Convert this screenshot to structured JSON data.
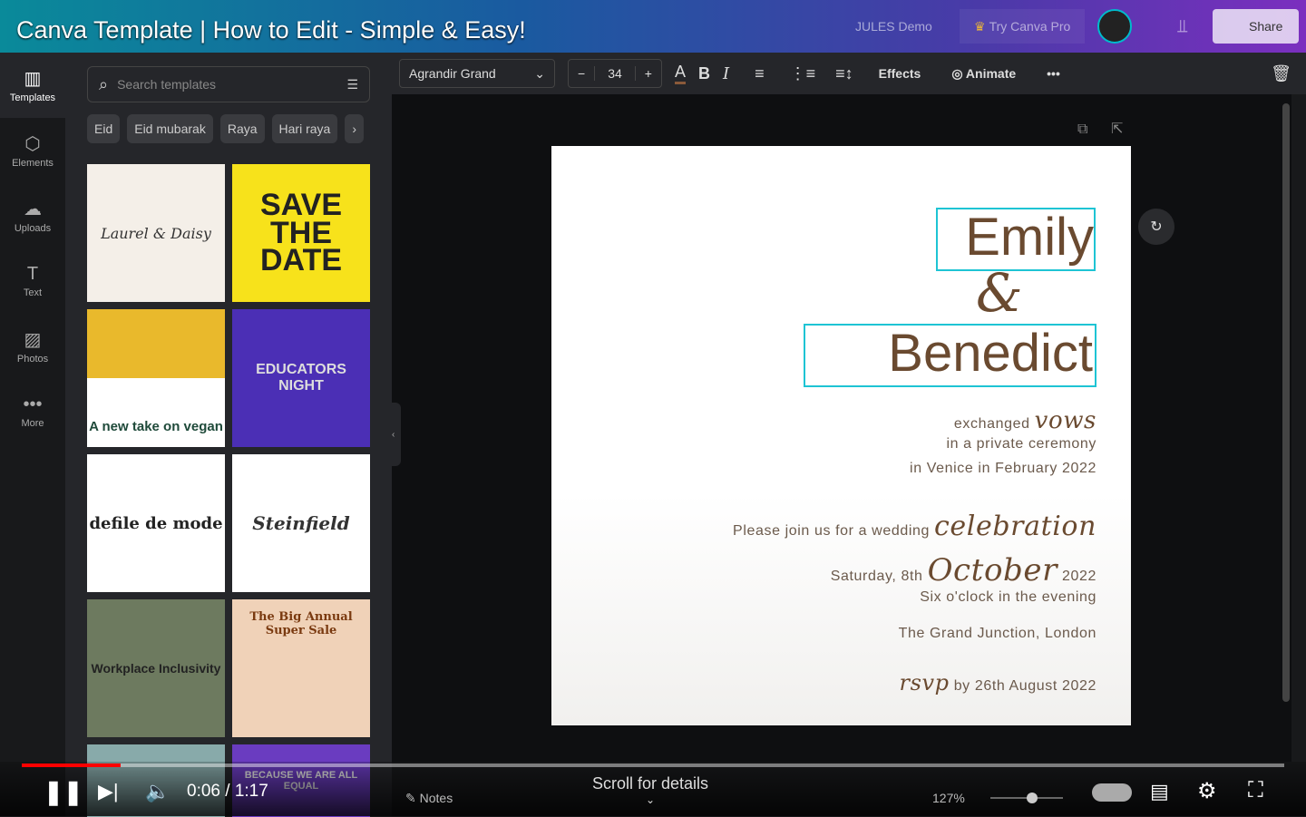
{
  "video": {
    "title": "Canva Template | How to Edit - Simple & Easy!",
    "time": "0:06 / 1:17",
    "progress": 0.078,
    "scroll_hint": "Scroll for details"
  },
  "canva_header": {
    "account": "JULES Demo",
    "try_pro": "Try Canva Pro",
    "share": "Share"
  },
  "rail": [
    {
      "icon": "▥",
      "label": "Templates"
    },
    {
      "icon": "⬡",
      "label": "Elements"
    },
    {
      "icon": "☁",
      "label": "Uploads"
    },
    {
      "icon": "T",
      "label": "Text"
    },
    {
      "icon": "▨",
      "label": "Photos"
    },
    {
      "icon": "•••",
      "label": "More"
    }
  ],
  "panel": {
    "search_placeholder": "Search templates",
    "chips": [
      "Eid",
      "Eid mubarak",
      "Raya",
      "Hari raya"
    ],
    "thumbs": [
      "Laurel & Daisy",
      "SAVE THE DATE",
      "A new take on vegan",
      "EDUCATORS NIGHT",
      "defile de mode",
      "Steinfield",
      "Workplace Inclusivity",
      "The Big Annual Super Sale",
      "",
      "BECAUSE WE ARE ALL EQUAL"
    ]
  },
  "toolbar": {
    "font": "Agrandir Grand",
    "size": "34",
    "effects": "Effects",
    "animate": "Animate"
  },
  "invite": {
    "name1": "Emily",
    "amp": "&",
    "name2": "Benedict",
    "l1a": "exchanged",
    "l1b": "vows",
    "l2": "in a private ceremony",
    "l3": "in Venice in February 2022",
    "l4a": "Please join us for a wedding",
    "l4b": "celebration",
    "l5a": "Saturday, 8th",
    "l5b": "October",
    "l5c": "2022",
    "l6": "Six o'clock in the evening",
    "l7": "The Grand Junction, London",
    "l8a": "rsvp",
    "l8b": "by 26th August 2022"
  },
  "footer": {
    "notes": "Notes",
    "zoom": "127%"
  }
}
